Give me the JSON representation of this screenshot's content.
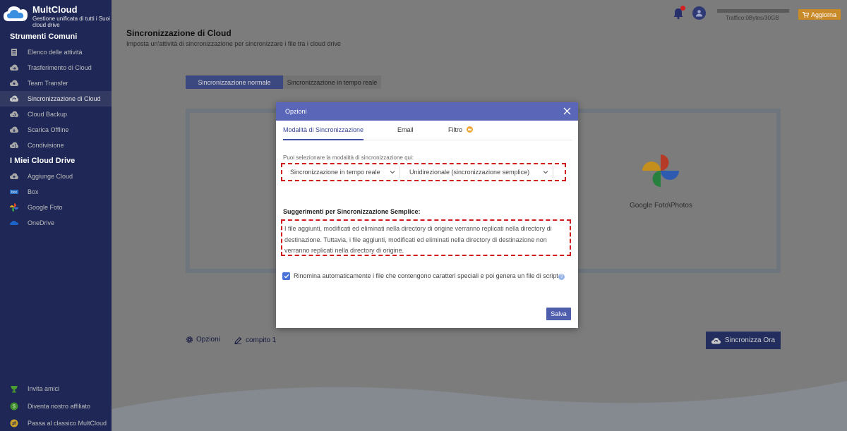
{
  "app": {
    "name": "MultCloud",
    "tagline": "Gestione unificata di tutti i Suoi cloud drive"
  },
  "sidebar": {
    "section_common": "Strumenti Comuni",
    "common_items": [
      {
        "label": "Elenco delle attività",
        "icon": "task-list-icon"
      },
      {
        "label": "Trasferimento di Cloud",
        "icon": "cloud-transfer-icon"
      },
      {
        "label": "Team Transfer",
        "icon": "team-transfer-icon"
      },
      {
        "label": "Sincronizzazione di Cloud",
        "icon": "cloud-sync-icon",
        "active": true
      },
      {
        "label": "Cloud Backup",
        "icon": "cloud-backup-icon"
      },
      {
        "label": "Scarica Offline",
        "icon": "offline-download-icon"
      },
      {
        "label": "Condivisione",
        "icon": "share-icon"
      }
    ],
    "section_drives": "I Miei Cloud Drive",
    "drive_items": [
      {
        "label": "Aggiunge Cloud",
        "icon": "add-cloud-icon"
      },
      {
        "label": "Box",
        "icon": "box-logo-icon"
      },
      {
        "label": "Google Foto",
        "icon": "google-photos-icon"
      },
      {
        "label": "OneDrive",
        "icon": "onedrive-icon"
      }
    ],
    "bottom_items": [
      {
        "label": "Invita amici",
        "icon": "gift-icon"
      },
      {
        "label": "Diventa nostro affiliato",
        "icon": "coin-icon"
      },
      {
        "label": "Passa al classico MultCloud",
        "icon": "switch-icon"
      }
    ]
  },
  "header": {
    "traffic": "Traffico:0Bytes/30GB",
    "traffic_used_fraction": 0,
    "upgrade": "Aggiorna"
  },
  "page": {
    "title": "Sincronizzazione di Cloud",
    "subtitle": "Imposta un'attività di sincronizzazione per sincronizzare i file tra i cloud drive",
    "tab_normal": "Sincronizzazione normale",
    "tab_realtime": "Sincronizzazione in tempo reale",
    "target_label": "Google Foto\\Photos",
    "options_link": "Opzioni",
    "task_link": "compito 1",
    "sync_now": "Sincronizza Ora"
  },
  "modal": {
    "title": "Opzioni",
    "tabs": [
      "Modalità di Sincronizzazione",
      "Email",
      "Filtro"
    ],
    "hint": "Puoi selezionare la modalità di sincronizzazione qui:",
    "select_mode": "Sincronizzazione in tempo reale",
    "select_direction": "Unidirezionale (sincronizzazione semplice)",
    "tips_title": "Suggerimenti per Sincronizzazione Semplice:",
    "tips_text": "I file aggiunti, modificati ed eliminati nella directory di origine verranno replicati nella directory di destinazione. Tuttavia, i file aggiunti, modificati ed eliminati nella directory di destinazione non verranno replicati nella directory di origine.",
    "rename_label": "Rinomina automaticamente i file che contengono caratteri speciali e poi genera un file di script.",
    "rename_checked": true,
    "save": "Salva"
  },
  "colors": {
    "sidebar_bg": "#1e2755",
    "accent": "#5a66b8",
    "highlight_border": "#d11a1a",
    "upgrade_bg": "#c98a2a"
  }
}
